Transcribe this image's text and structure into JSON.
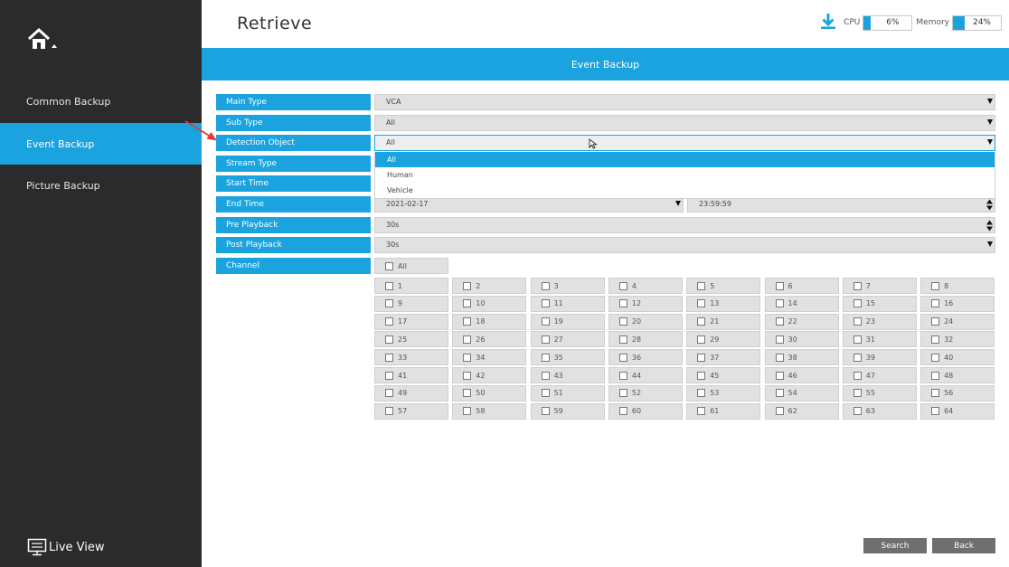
{
  "header": {
    "title": "Retrieve"
  },
  "status": {
    "cpu_label": "CPU",
    "cpu_value": "6%",
    "cpu_level": 0.06,
    "memory_label": "Memory",
    "memory_value": "24%",
    "memory_level": 0.24
  },
  "banner": {
    "title": "Event Backup"
  },
  "sidebar": {
    "items": [
      {
        "label": "Common Backup"
      },
      {
        "label": "Event Backup"
      },
      {
        "label": "Picture Backup"
      }
    ],
    "live_view": "Live View"
  },
  "form": {
    "main_type": {
      "label": "Main Type",
      "value": "VCA"
    },
    "sub_type": {
      "label": "Sub Type",
      "value": "All"
    },
    "detection_object": {
      "label": "Detection Object",
      "value": "All",
      "options": [
        "All",
        "Human",
        "Vehicle"
      ]
    },
    "stream_type": {
      "label": "Stream Type"
    },
    "start_time": {
      "label": "Start Time"
    },
    "end_time": {
      "label": "End Time",
      "date": "2021-02-17",
      "time": "23:59:59"
    },
    "pre_playback": {
      "label": "Pre Playback",
      "value": "30s"
    },
    "post_playback": {
      "label": "Post Playback",
      "value": "30s"
    },
    "channel": {
      "label": "Channel",
      "all_label": "All",
      "channels": [
        "1",
        "2",
        "3",
        "4",
        "5",
        "6",
        "7",
        "8",
        "9",
        "10",
        "11",
        "12",
        "13",
        "14",
        "15",
        "16",
        "17",
        "18",
        "19",
        "20",
        "21",
        "22",
        "23",
        "24",
        "25",
        "26",
        "27",
        "28",
        "29",
        "30",
        "31",
        "32",
        "33",
        "34",
        "35",
        "36",
        "37",
        "38",
        "39",
        "40",
        "41",
        "42",
        "43",
        "44",
        "45",
        "46",
        "47",
        "48",
        "49",
        "50",
        "51",
        "52",
        "53",
        "54",
        "55",
        "56",
        "57",
        "58",
        "59",
        "60",
        "61",
        "62",
        "63",
        "64"
      ]
    }
  },
  "buttons": {
    "search": "Search",
    "back": "Back"
  },
  "colors": {
    "accent": "#1ba3e0",
    "sidebar": "#2b2b2b",
    "annotation_arrow": "#e53935"
  }
}
